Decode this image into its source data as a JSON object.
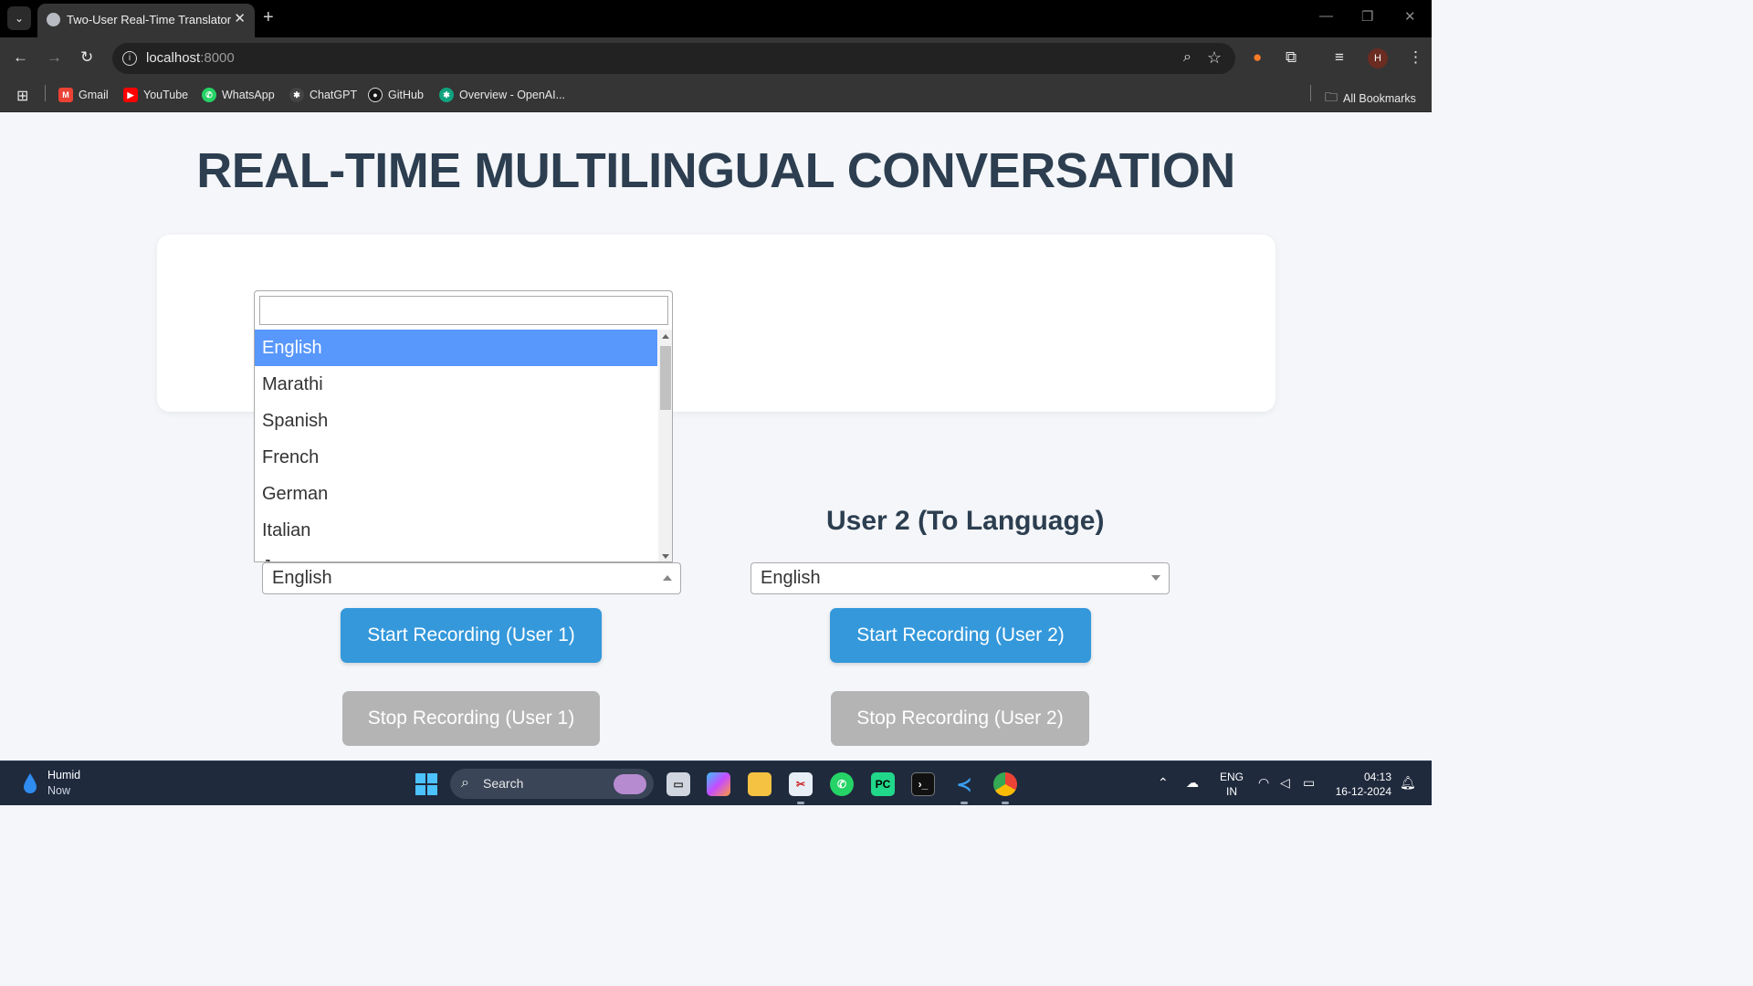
{
  "browser": {
    "tab_title": "Two-User Real-Time Translator",
    "tab_close": "✕",
    "new_tab": "+",
    "url_host": "localhost",
    "url_port": ":8000",
    "profile_initial": "H",
    "bookmarks": [
      {
        "label": "Gmail",
        "color": "#ea4335",
        "icon": "M"
      },
      {
        "label": "YouTube",
        "color": "#ff0000",
        "icon": "▶"
      },
      {
        "label": "WhatsApp",
        "color": "#25d366",
        "icon": "✆"
      },
      {
        "label": "ChatGPT",
        "color": "#202123",
        "icon": "✱"
      },
      {
        "label": "GitHub",
        "color": "#181717",
        "icon": "●"
      },
      {
        "label": "Overview - OpenAI...",
        "color": "#10a37f",
        "icon": "✱"
      }
    ],
    "all_bookmarks": "All Bookmarks"
  },
  "page": {
    "title": "REAL-TIME MULTILINGUAL CONVERSATION",
    "user2_heading": "User 2 (To Language)",
    "user1_select_value": "English",
    "user2_select_value": "English",
    "buttons": {
      "start_user1": "Start Recording (User 1)",
      "stop_user1": "Stop Recording (User 1)",
      "start_user2": "Start Recording (User 2)",
      "stop_user2": "Stop Recording (User 2)"
    },
    "dropdown": {
      "search_value": "",
      "highlighted": "English",
      "options": [
        "English",
        "Marathi",
        "Spanish",
        "French",
        "German",
        "Italian",
        "J..."
      ]
    }
  },
  "taskbar": {
    "weather_title": "Humid",
    "weather_sub": "Now",
    "search_label": "Search",
    "lang_line1": "ENG",
    "lang_line2": "IN",
    "time": "04:13",
    "date": "16-12-2024"
  },
  "colors": {
    "title": "#2c3e50",
    "start_button": "#3498db",
    "stop_button": "#b4b4b4",
    "highlight": "#5897fb"
  }
}
